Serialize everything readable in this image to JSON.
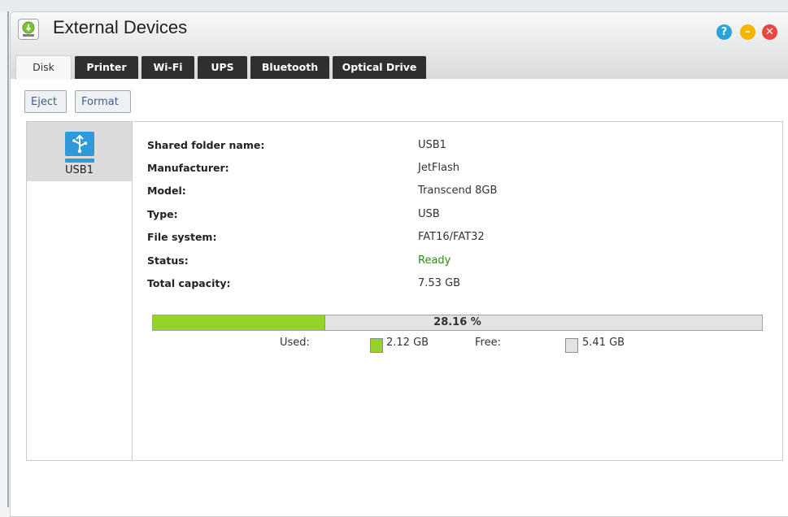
{
  "window": {
    "title": "External Devices",
    "help_glyph": "?",
    "minimize_glyph": "–",
    "close_glyph": "✕"
  },
  "tabs": [
    {
      "label": "Disk",
      "active": true
    },
    {
      "label": "Printer",
      "active": false
    },
    {
      "label": "Wi-Fi",
      "active": false
    },
    {
      "label": "UPS",
      "active": false
    },
    {
      "label": "Bluetooth",
      "active": false
    },
    {
      "label": "Optical Drive",
      "active": false
    }
  ],
  "toolbar": {
    "eject_label": "Eject",
    "format_label": "Format"
  },
  "devices": [
    {
      "name": "USB1",
      "icon": "usb-drive-icon",
      "selected": true
    }
  ],
  "details": [
    {
      "label": "Shared folder name:",
      "value": "USB1"
    },
    {
      "label": "Manufacturer:",
      "value": "JetFlash"
    },
    {
      "label": "Model:",
      "value": "Transcend 8GB"
    },
    {
      "label": "Type:",
      "value": "USB"
    },
    {
      "label": "File system:",
      "value": "FAT16/FAT32"
    },
    {
      "label": "Status:",
      "value": "Ready"
    },
    {
      "label": "Total capacity:",
      "value": "7.53 GB"
    }
  ],
  "usage": {
    "percent_used": 28.16,
    "percent_text": "28.16 %",
    "used_label": "Used:",
    "used_value": "2.12 GB",
    "free_label": "Free:",
    "free_value": "5.41 GB"
  },
  "colors": {
    "used": "#95d22a",
    "free": "#e3e3e3",
    "status_ready": "#2f8a16",
    "active_tab_text": "#333333",
    "tab_background": "#2f2f2f",
    "toolbar_text": "#3c5f8c"
  }
}
